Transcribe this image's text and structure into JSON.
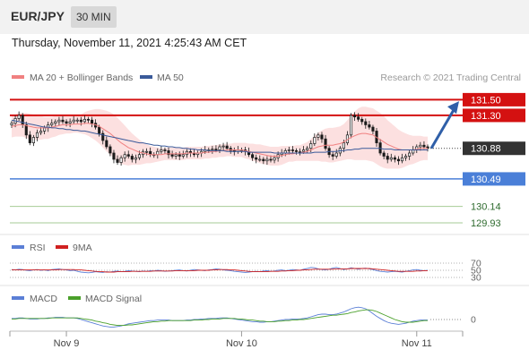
{
  "header": {
    "symbol": "EUR/JPY",
    "timeframe": "30 MIN"
  },
  "datetime": "Thursday, November 11, 2021 4:25:43 AM CET",
  "credit": "Research © 2021 Trading Central",
  "colors": {
    "ma20": "#f08080",
    "ma50": "#3a5a9a",
    "bollinger": "#fbd3d3",
    "resistance": "#d41111",
    "current": "#333333",
    "support": "#4a7fd8",
    "support_extra": "#6aa84f",
    "arrow": "#2f5fa8",
    "candle_up": "#1a1a1a",
    "candle_down": "#1a1a1a",
    "rsi": "#5b7fd6",
    "rsi_ma": "#d02020",
    "macd": "#5b7fd6",
    "macd_signal": "#4aa02a"
  },
  "chart_data": [
    {
      "type": "candlestick",
      "legend": [
        "MA 20 + Bollinger Bands",
        "MA 50"
      ],
      "ylim": [
        129.85,
        131.63
      ],
      "x_tick_labels": [
        {
          "label": "Nov 9",
          "index": 15
        },
        {
          "label": "Nov 10",
          "index": 63
        },
        {
          "label": "Nov 11",
          "index": 111
        }
      ],
      "levels": [
        {
          "value": 131.5,
          "label": "131.50",
          "kind": "resistance"
        },
        {
          "value": 131.3,
          "label": "131.30",
          "kind": "resistance"
        },
        {
          "value": 130.88,
          "label": "130.88",
          "kind": "current"
        },
        {
          "value": 130.49,
          "label": "130.49",
          "kind": "support"
        },
        {
          "value": 130.14,
          "label": "130.14",
          "kind": "support_extra"
        },
        {
          "value": 129.93,
          "label": "129.93",
          "kind": "support_extra"
        }
      ],
      "forecast_arrow": {
        "from": 130.88,
        "to": 131.48
      },
      "closes": [
        131.2,
        131.26,
        131.3,
        131.18,
        131.05,
        130.95,
        131.02,
        131.08,
        131.1,
        131.14,
        131.18,
        131.2,
        131.22,
        131.24,
        131.22,
        131.2,
        131.22,
        131.24,
        131.24,
        131.22,
        131.25,
        131.24,
        131.2,
        131.15,
        131.07,
        130.98,
        130.9,
        130.82,
        130.74,
        130.7,
        130.76,
        130.8,
        130.78,
        130.74,
        130.76,
        130.8,
        130.84,
        130.84,
        130.8,
        130.8,
        130.84,
        130.86,
        130.85,
        130.8,
        130.78,
        130.8,
        130.78,
        130.8,
        130.84,
        130.82,
        130.8,
        130.82,
        130.84,
        130.86,
        130.86,
        130.87,
        130.86,
        130.9,
        130.91,
        130.88,
        130.85,
        130.84,
        130.86,
        130.86,
        130.84,
        130.8,
        130.76,
        130.74,
        130.74,
        130.72,
        130.74,
        130.73,
        130.76,
        130.8,
        130.82,
        130.85,
        130.86,
        130.85,
        130.84,
        130.84,
        130.86,
        130.88,
        130.94,
        131.02,
        131.05,
        131.0,
        130.88,
        130.8,
        130.78,
        130.82,
        130.88,
        130.95,
        131.05,
        131.3,
        131.28,
        131.25,
        131.22,
        131.18,
        131.15,
        131.1,
        130.95,
        130.82,
        130.78,
        130.74,
        130.76,
        130.74,
        130.72,
        130.76,
        130.78,
        130.82,
        130.86,
        130.9,
        130.92,
        130.9,
        130.88
      ],
      "ma20": [
        131.16,
        131.17,
        131.18,
        131.18,
        131.17,
        131.16,
        131.15,
        131.14,
        131.14,
        131.14,
        131.14,
        131.15,
        131.16,
        131.17,
        131.18,
        131.18,
        131.18,
        131.19,
        131.19,
        131.19,
        131.2,
        131.2,
        131.19,
        131.18,
        131.16,
        131.13,
        131.1,
        131.07,
        131.03,
        130.99,
        130.95,
        130.92,
        130.89,
        130.87,
        130.85,
        130.83,
        130.82,
        130.81,
        130.8,
        130.8,
        130.8,
        130.8,
        130.81,
        130.81,
        130.81,
        130.81,
        130.81,
        130.81,
        130.82,
        130.82,
        130.82,
        130.82,
        130.82,
        130.83,
        130.83,
        130.84,
        130.84,
        130.85,
        130.85,
        130.86,
        130.86,
        130.86,
        130.86,
        130.86,
        130.85,
        130.84,
        130.83,
        130.82,
        130.81,
        130.8,
        130.79,
        130.78,
        130.78,
        130.78,
        130.79,
        130.8,
        130.81,
        130.81,
        130.82,
        130.82,
        130.83,
        130.84,
        130.86,
        130.88,
        130.9,
        130.91,
        130.92,
        130.92,
        130.92,
        130.93,
        130.94,
        130.96,
        130.99,
        131.02,
        131.04,
        131.06,
        131.07,
        131.07,
        131.06,
        131.05,
        131.02,
        130.99,
        130.96,
        130.93,
        130.91,
        130.89,
        130.87,
        130.86,
        130.86,
        130.86,
        130.86,
        130.87,
        130.88,
        130.88,
        130.88
      ],
      "bb_width": [
        0.14,
        0.14,
        0.15,
        0.15,
        0.16,
        0.16,
        0.16,
        0.15,
        0.15,
        0.14,
        0.14,
        0.13,
        0.13,
        0.12,
        0.12,
        0.11,
        0.11,
        0.11,
        0.11,
        0.12,
        0.14,
        0.16,
        0.18,
        0.2,
        0.22,
        0.24,
        0.26,
        0.27,
        0.28,
        0.28,
        0.27,
        0.25,
        0.23,
        0.2,
        0.18,
        0.16,
        0.14,
        0.12,
        0.11,
        0.1,
        0.09,
        0.08,
        0.08,
        0.08,
        0.08,
        0.08,
        0.08,
        0.08,
        0.08,
        0.08,
        0.08,
        0.08,
        0.08,
        0.08,
        0.08,
        0.08,
        0.08,
        0.08,
        0.08,
        0.08,
        0.08,
        0.09,
        0.09,
        0.09,
        0.1,
        0.1,
        0.11,
        0.11,
        0.12,
        0.12,
        0.12,
        0.12,
        0.12,
        0.12,
        0.12,
        0.11,
        0.1,
        0.1,
        0.1,
        0.1,
        0.11,
        0.12,
        0.14,
        0.16,
        0.18,
        0.2,
        0.21,
        0.22,
        0.22,
        0.22,
        0.22,
        0.23,
        0.25,
        0.28,
        0.31,
        0.33,
        0.34,
        0.34,
        0.34,
        0.34,
        0.34,
        0.34,
        0.33,
        0.31,
        0.29,
        0.27,
        0.25,
        0.23,
        0.21,
        0.19,
        0.18,
        0.17,
        0.16,
        0.15,
        0.15
      ],
      "ma50": [
        131.24,
        131.23,
        131.22,
        131.21,
        131.2,
        131.19,
        131.18,
        131.17,
        131.16,
        131.15,
        131.15,
        131.14,
        131.14,
        131.13,
        131.13,
        131.12,
        131.12,
        131.11,
        131.11,
        131.1,
        131.1,
        131.09,
        131.08,
        131.07,
        131.06,
        131.05,
        131.04,
        131.03,
        131.02,
        131.01,
        131.0,
        130.99,
        130.98,
        130.97,
        130.96,
        130.95,
        130.95,
        130.94,
        130.93,
        130.92,
        130.92,
        130.91,
        130.91,
        130.9,
        130.9,
        130.89,
        130.89,
        130.88,
        130.88,
        130.87,
        130.87,
        130.86,
        130.86,
        130.86,
        130.85,
        130.85,
        130.85,
        130.85,
        130.85,
        130.84,
        130.84,
        130.84,
        130.84,
        130.84,
        130.84,
        130.83,
        130.83,
        130.83,
        130.83,
        130.83,
        130.83,
        130.83,
        130.82,
        130.82,
        130.82,
        130.82,
        130.82,
        130.82,
        130.82,
        130.82,
        130.82,
        130.82,
        130.82,
        130.83,
        130.83,
        130.83,
        130.83,
        130.84,
        130.84,
        130.84,
        130.85,
        130.85,
        130.86,
        130.86,
        130.87,
        130.87,
        130.88,
        130.88,
        130.88,
        130.88,
        130.88,
        130.88,
        130.87,
        130.87,
        130.87,
        130.86,
        130.86,
        130.86,
        130.86,
        130.86,
        130.86,
        130.86,
        130.86,
        130.86,
        130.86
      ]
    },
    {
      "type": "line",
      "legend": [
        "RSI",
        "9MA"
      ],
      "ylim": [
        20,
        80
      ],
      "y_tick_labels": [
        "70",
        "50",
        "30"
      ],
      "rsi": [
        52,
        51,
        53,
        52,
        50,
        49,
        51,
        52,
        50,
        51,
        49,
        52,
        53,
        54,
        52,
        51,
        49,
        50,
        47,
        45,
        44,
        43,
        44,
        46,
        45,
        44,
        46,
        45,
        47,
        48,
        46,
        47,
        49,
        48,
        47,
        46,
        48,
        47,
        49,
        48,
        50,
        49,
        47,
        48,
        49,
        50,
        51,
        49,
        48,
        50,
        52,
        51,
        50,
        49,
        51,
        52,
        54,
        53,
        51,
        50,
        49,
        47,
        46,
        45,
        44,
        45,
        46,
        47,
        46,
        48,
        49,
        47,
        48,
        50,
        51,
        49,
        50,
        52,
        51,
        50,
        53,
        55,
        58,
        57,
        54,
        52,
        51,
        53,
        56,
        58,
        55,
        52,
        54,
        57,
        55,
        53,
        55,
        56,
        54,
        52,
        49,
        47,
        46,
        45,
        46,
        47,
        46,
        45,
        47,
        49,
        51,
        52,
        50,
        49,
        50
      ],
      "ma9": [
        51,
        51,
        51,
        51,
        51,
        51,
        51,
        51,
        51,
        51,
        51,
        51,
        51,
        52,
        52,
        52,
        52,
        52,
        51,
        51,
        50,
        49,
        48,
        47,
        46,
        46,
        45,
        45,
        45,
        46,
        46,
        46,
        46,
        47,
        47,
        47,
        47,
        47,
        47,
        48,
        48,
        48,
        48,
        48,
        48,
        49,
        49,
        49,
        49,
        49,
        49,
        50,
        50,
        50,
        50,
        51,
        51,
        52,
        52,
        52,
        51,
        51,
        50,
        49,
        48,
        47,
        46,
        46,
        46,
        46,
        46,
        47,
        47,
        47,
        48,
        48,
        49,
        49,
        50,
        50,
        51,
        51,
        52,
        53,
        53,
        53,
        53,
        53,
        53,
        54,
        54,
        54,
        54,
        55,
        55,
        55,
        55,
        55,
        55,
        54,
        53,
        52,
        51,
        50,
        49,
        48,
        47,
        47,
        47,
        47,
        47,
        48,
        48,
        49,
        49
      ]
    },
    {
      "type": "line",
      "legend": [
        "MACD",
        "MACD Signal"
      ],
      "y_tick_labels": [
        "0"
      ],
      "macd": [
        0.02,
        0.02,
        0.03,
        0.03,
        0.02,
        0.01,
        0.01,
        0.01,
        0.02,
        0.02,
        0.03,
        0.03,
        0.04,
        0.04,
        0.04,
        0.03,
        0.03,
        0.03,
        0.02,
        0.0,
        -0.02,
        -0.04,
        -0.06,
        -0.08,
        -0.1,
        -0.12,
        -0.13,
        -0.14,
        -0.14,
        -0.13,
        -0.12,
        -0.1,
        -0.08,
        -0.07,
        -0.06,
        -0.05,
        -0.04,
        -0.03,
        -0.02,
        -0.02,
        -0.01,
        -0.01,
        -0.01,
        -0.01,
        -0.02,
        -0.02,
        -0.02,
        -0.02,
        -0.01,
        -0.01,
        0.0,
        0.0,
        0.01,
        0.01,
        0.02,
        0.02,
        0.02,
        0.03,
        0.03,
        0.03,
        0.02,
        0.01,
        0.0,
        -0.01,
        -0.02,
        -0.03,
        -0.04,
        -0.04,
        -0.05,
        -0.05,
        -0.04,
        -0.04,
        -0.03,
        -0.02,
        -0.01,
        0.0,
        0.0,
        0.01,
        0.01,
        0.01,
        0.02,
        0.03,
        0.05,
        0.07,
        0.09,
        0.1,
        0.1,
        0.09,
        0.09,
        0.1,
        0.12,
        0.14,
        0.17,
        0.2,
        0.22,
        0.23,
        0.22,
        0.2,
        0.16,
        0.11,
        0.06,
        0.02,
        -0.02,
        -0.05,
        -0.07,
        -0.08,
        -0.09,
        -0.08,
        -0.07,
        -0.05,
        -0.03,
        -0.02,
        -0.01,
        -0.01,
        -0.01
      ],
      "signal": [
        0.01,
        0.01,
        0.02,
        0.02,
        0.02,
        0.02,
        0.02,
        0.02,
        0.02,
        0.02,
        0.02,
        0.03,
        0.03,
        0.03,
        0.03,
        0.03,
        0.03,
        0.03,
        0.03,
        0.02,
        0.01,
        0.0,
        -0.01,
        -0.03,
        -0.04,
        -0.06,
        -0.07,
        -0.09,
        -0.1,
        -0.11,
        -0.11,
        -0.11,
        -0.1,
        -0.1,
        -0.09,
        -0.08,
        -0.07,
        -0.06,
        -0.05,
        -0.04,
        -0.04,
        -0.03,
        -0.03,
        -0.02,
        -0.02,
        -0.02,
        -0.02,
        -0.02,
        -0.02,
        -0.02,
        -0.01,
        -0.01,
        -0.01,
        0.0,
        0.0,
        0.01,
        0.01,
        0.01,
        0.02,
        0.02,
        0.02,
        0.02,
        0.01,
        0.01,
        0.0,
        -0.01,
        -0.01,
        -0.02,
        -0.03,
        -0.03,
        -0.04,
        -0.04,
        -0.04,
        -0.03,
        -0.03,
        -0.02,
        -0.02,
        -0.01,
        -0.01,
        0.0,
        0.0,
        0.01,
        0.02,
        0.03,
        0.04,
        0.05,
        0.06,
        0.07,
        0.08,
        0.08,
        0.09,
        0.1,
        0.11,
        0.13,
        0.14,
        0.16,
        0.17,
        0.18,
        0.18,
        0.17,
        0.15,
        0.12,
        0.09,
        0.06,
        0.03,
        0.0,
        -0.02,
        -0.04,
        -0.05,
        -0.05,
        -0.05,
        -0.04,
        -0.03,
        -0.02,
        -0.02
      ]
    }
  ]
}
